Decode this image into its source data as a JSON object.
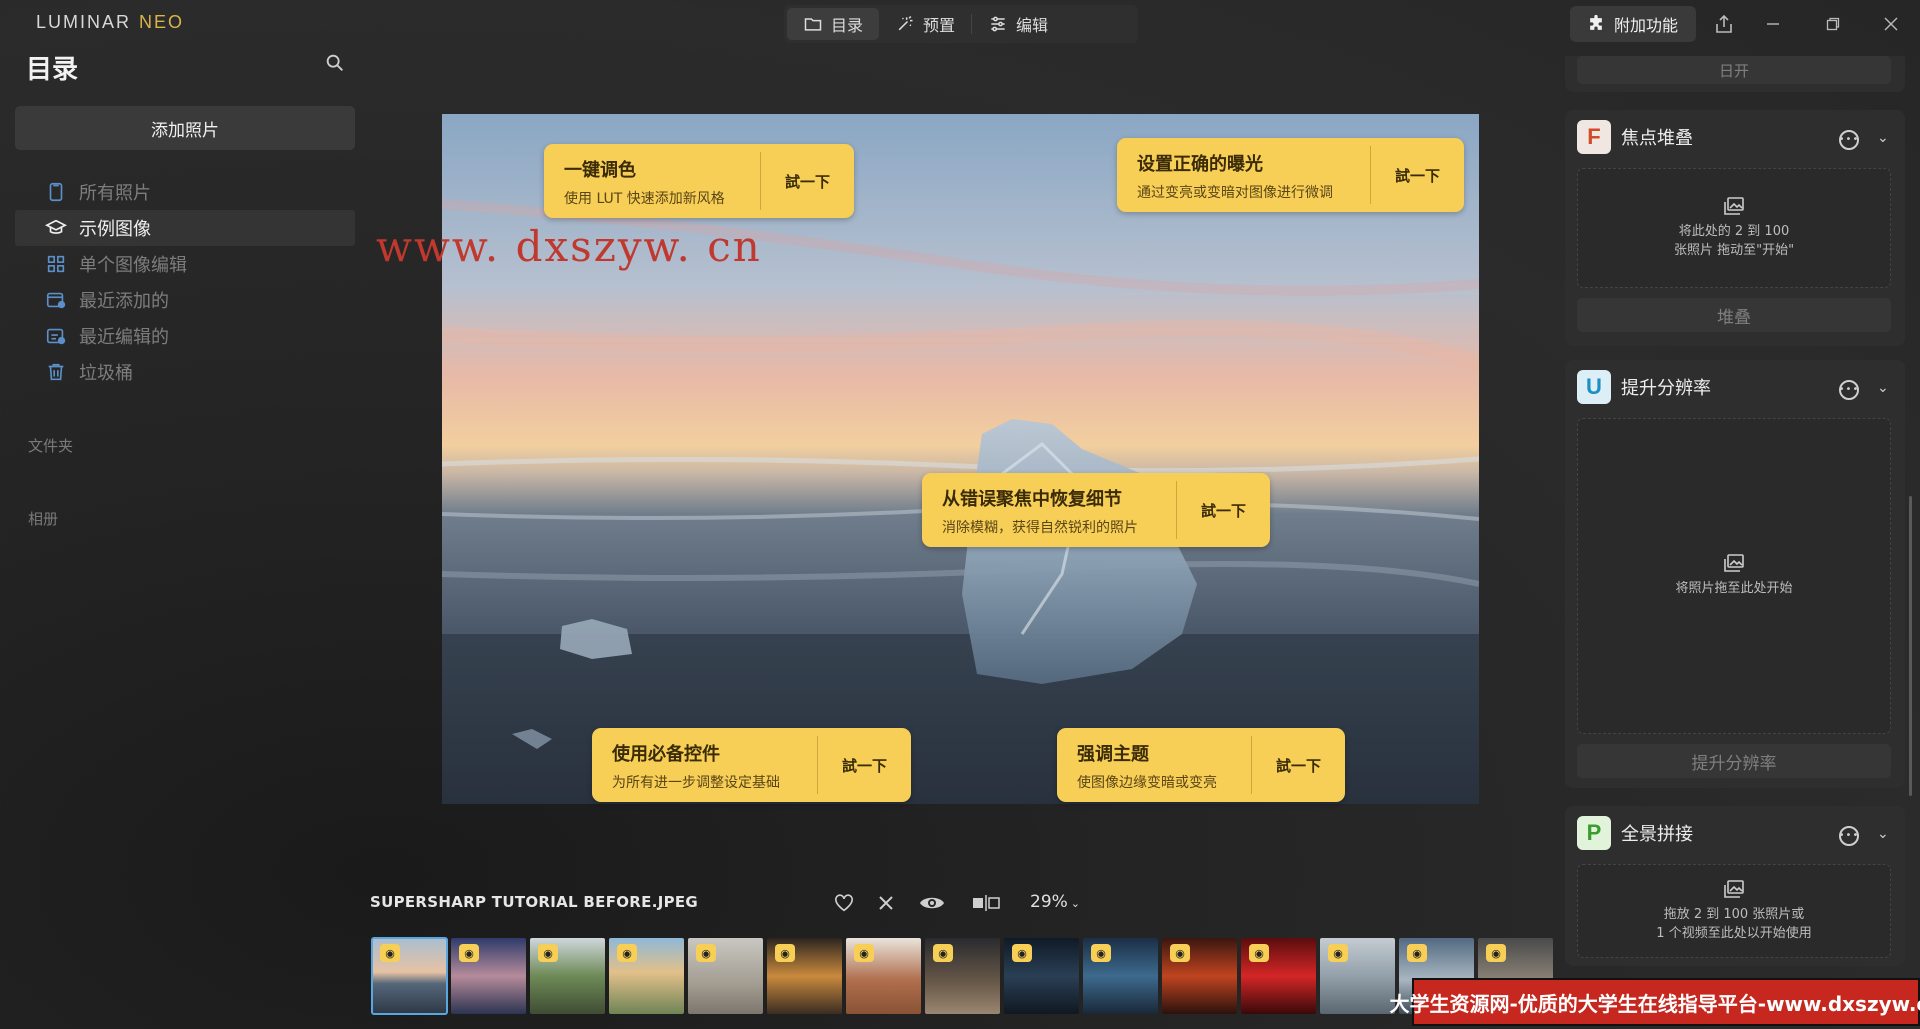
{
  "app": {
    "logo_main": "LUMINAR",
    "logo_accent": "NEO"
  },
  "modes": [
    {
      "label": "目录",
      "icon": "folder-icon",
      "active": true
    },
    {
      "label": "预置",
      "icon": "magic-wand-icon",
      "active": false
    },
    {
      "label": "编辑",
      "icon": "sliders-icon",
      "active": false
    }
  ],
  "header": {
    "addon_label": "附加功能"
  },
  "sidebar": {
    "title": "目录",
    "add_photos": "添加照片",
    "items": [
      {
        "label": "所有照片",
        "icon": "phone-icon",
        "active": false
      },
      {
        "label": "示例图像",
        "icon": "graduation-cap-icon",
        "active": true
      },
      {
        "label": "单个图像编辑",
        "icon": "grid-icon",
        "active": false
      },
      {
        "label": "最近添加的",
        "icon": "calendar-add-icon",
        "active": false
      },
      {
        "label": "最近编辑的",
        "icon": "edit-recent-icon",
        "active": false
      },
      {
        "label": "垃圾桶",
        "icon": "trash-icon",
        "active": false
      }
    ],
    "folders_label": "文件夹",
    "albums_label": "相册"
  },
  "tips": [
    {
      "title": "一键调色",
      "desc": "使用 LUT 快速添加新风格",
      "action": "試一下"
    },
    {
      "title": "设置正确的曝光",
      "desc": "通过变亮或变暗对图像进行微调",
      "action": "試一下"
    },
    {
      "title": "从错误聚焦中恢复细节",
      "desc": "消除模糊，获得自然锐利的照片",
      "action": "試一下"
    },
    {
      "title": "使用必备控件",
      "desc": "为所有进一步调整设定基础",
      "action": "試一下"
    },
    {
      "title": "强调主题",
      "desc": "使图像边缘变暗或变亮",
      "action": "試一下"
    }
  ],
  "watermark": "www. dxszyw. cn",
  "info": {
    "filename": "SUPERSHARP TUTORIAL BEFORE.JPEG",
    "zoom": "29%"
  },
  "filmstrip_count": 15,
  "right_panel": {
    "top_partial_action": "日开",
    "focus_stack": {
      "tile": "F",
      "title": "焦点堆叠",
      "drop_line1": "将此处的 2 到 100",
      "drop_line2": "张照片 拖动至\"开始\"",
      "action": "堆叠"
    },
    "upscale": {
      "tile": "U",
      "title": "提升分辨率",
      "drop_text": "将照片拖至此处开始",
      "action": "提升分辨率"
    },
    "panorama": {
      "tile": "P",
      "title": "全景拼接",
      "drop_line1": "拖放 2 到 100 张照片或",
      "drop_line2": "1 个视频至此处以开始使用"
    }
  },
  "banner": "大学生资源网-优质的大学生在线指导平台-www.dxszyw.cn",
  "colors": {
    "tip_bg": "#f7cf57",
    "accent_blue": "#5aa7e0",
    "logo_accent": "#d9b44a"
  }
}
